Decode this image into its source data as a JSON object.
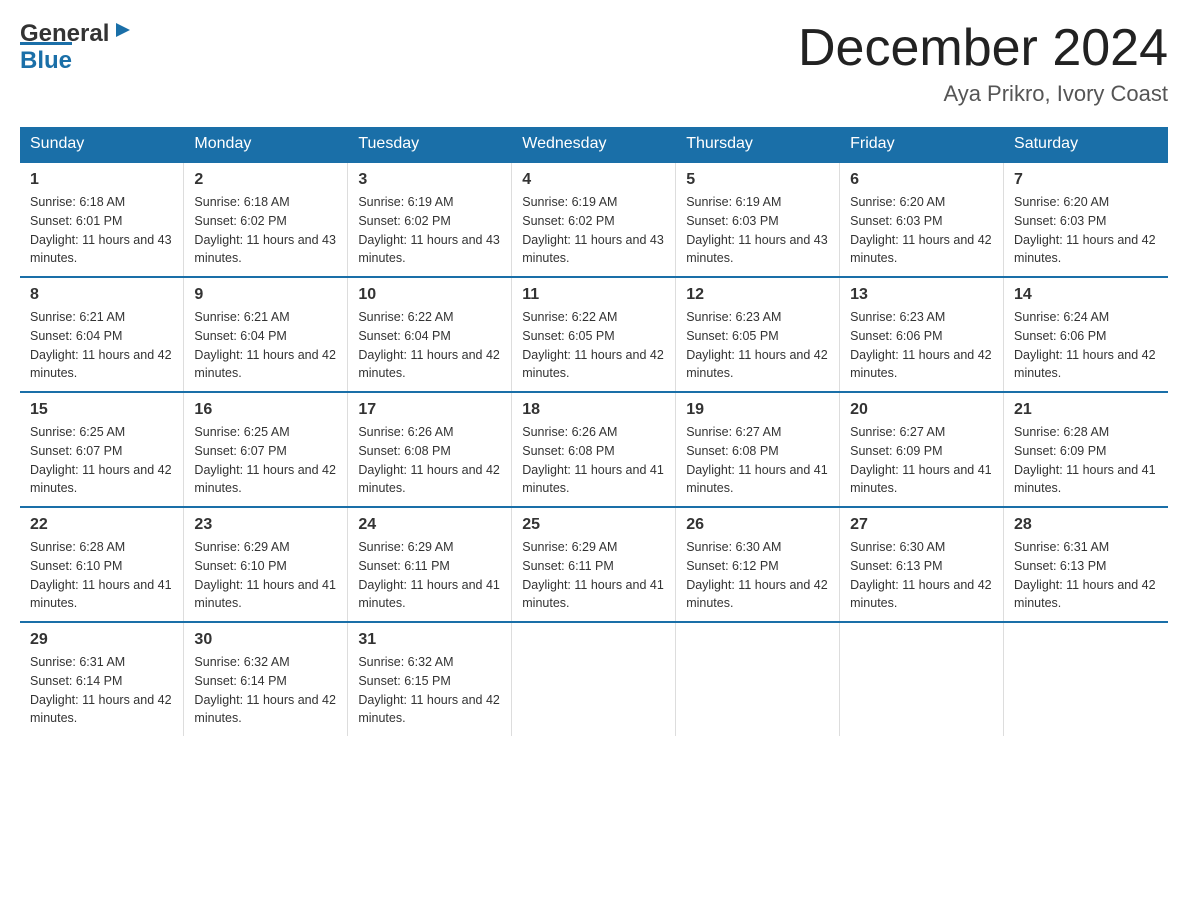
{
  "logo": {
    "text_general": "General",
    "text_blue": "Blue",
    "alt": "GeneralBlue Logo"
  },
  "title": "December 2024",
  "subtitle": "Aya Prikro, Ivory Coast",
  "days_of_week": [
    "Sunday",
    "Monday",
    "Tuesday",
    "Wednesday",
    "Thursday",
    "Friday",
    "Saturday"
  ],
  "weeks": [
    [
      {
        "day": "1",
        "sunrise": "6:18 AM",
        "sunset": "6:01 PM",
        "daylight": "11 hours and 43 minutes."
      },
      {
        "day": "2",
        "sunrise": "6:18 AM",
        "sunset": "6:02 PM",
        "daylight": "11 hours and 43 minutes."
      },
      {
        "day": "3",
        "sunrise": "6:19 AM",
        "sunset": "6:02 PM",
        "daylight": "11 hours and 43 minutes."
      },
      {
        "day": "4",
        "sunrise": "6:19 AM",
        "sunset": "6:02 PM",
        "daylight": "11 hours and 43 minutes."
      },
      {
        "day": "5",
        "sunrise": "6:19 AM",
        "sunset": "6:03 PM",
        "daylight": "11 hours and 43 minutes."
      },
      {
        "day": "6",
        "sunrise": "6:20 AM",
        "sunset": "6:03 PM",
        "daylight": "11 hours and 42 minutes."
      },
      {
        "day": "7",
        "sunrise": "6:20 AM",
        "sunset": "6:03 PM",
        "daylight": "11 hours and 42 minutes."
      }
    ],
    [
      {
        "day": "8",
        "sunrise": "6:21 AM",
        "sunset": "6:04 PM",
        "daylight": "11 hours and 42 minutes."
      },
      {
        "day": "9",
        "sunrise": "6:21 AM",
        "sunset": "6:04 PM",
        "daylight": "11 hours and 42 minutes."
      },
      {
        "day": "10",
        "sunrise": "6:22 AM",
        "sunset": "6:04 PM",
        "daylight": "11 hours and 42 minutes."
      },
      {
        "day": "11",
        "sunrise": "6:22 AM",
        "sunset": "6:05 PM",
        "daylight": "11 hours and 42 minutes."
      },
      {
        "day": "12",
        "sunrise": "6:23 AM",
        "sunset": "6:05 PM",
        "daylight": "11 hours and 42 minutes."
      },
      {
        "day": "13",
        "sunrise": "6:23 AM",
        "sunset": "6:06 PM",
        "daylight": "11 hours and 42 minutes."
      },
      {
        "day": "14",
        "sunrise": "6:24 AM",
        "sunset": "6:06 PM",
        "daylight": "11 hours and 42 minutes."
      }
    ],
    [
      {
        "day": "15",
        "sunrise": "6:25 AM",
        "sunset": "6:07 PM",
        "daylight": "11 hours and 42 minutes."
      },
      {
        "day": "16",
        "sunrise": "6:25 AM",
        "sunset": "6:07 PM",
        "daylight": "11 hours and 42 minutes."
      },
      {
        "day": "17",
        "sunrise": "6:26 AM",
        "sunset": "6:08 PM",
        "daylight": "11 hours and 42 minutes."
      },
      {
        "day": "18",
        "sunrise": "6:26 AM",
        "sunset": "6:08 PM",
        "daylight": "11 hours and 41 minutes."
      },
      {
        "day": "19",
        "sunrise": "6:27 AM",
        "sunset": "6:08 PM",
        "daylight": "11 hours and 41 minutes."
      },
      {
        "day": "20",
        "sunrise": "6:27 AM",
        "sunset": "6:09 PM",
        "daylight": "11 hours and 41 minutes."
      },
      {
        "day": "21",
        "sunrise": "6:28 AM",
        "sunset": "6:09 PM",
        "daylight": "11 hours and 41 minutes."
      }
    ],
    [
      {
        "day": "22",
        "sunrise": "6:28 AM",
        "sunset": "6:10 PM",
        "daylight": "11 hours and 41 minutes."
      },
      {
        "day": "23",
        "sunrise": "6:29 AM",
        "sunset": "6:10 PM",
        "daylight": "11 hours and 41 minutes."
      },
      {
        "day": "24",
        "sunrise": "6:29 AM",
        "sunset": "6:11 PM",
        "daylight": "11 hours and 41 minutes."
      },
      {
        "day": "25",
        "sunrise": "6:29 AM",
        "sunset": "6:11 PM",
        "daylight": "11 hours and 41 minutes."
      },
      {
        "day": "26",
        "sunrise": "6:30 AM",
        "sunset": "6:12 PM",
        "daylight": "11 hours and 42 minutes."
      },
      {
        "day": "27",
        "sunrise": "6:30 AM",
        "sunset": "6:13 PM",
        "daylight": "11 hours and 42 minutes."
      },
      {
        "day": "28",
        "sunrise": "6:31 AM",
        "sunset": "6:13 PM",
        "daylight": "11 hours and 42 minutes."
      }
    ],
    [
      {
        "day": "29",
        "sunrise": "6:31 AM",
        "sunset": "6:14 PM",
        "daylight": "11 hours and 42 minutes."
      },
      {
        "day": "30",
        "sunrise": "6:32 AM",
        "sunset": "6:14 PM",
        "daylight": "11 hours and 42 minutes."
      },
      {
        "day": "31",
        "sunrise": "6:32 AM",
        "sunset": "6:15 PM",
        "daylight": "11 hours and 42 minutes."
      },
      null,
      null,
      null,
      null
    ]
  ]
}
